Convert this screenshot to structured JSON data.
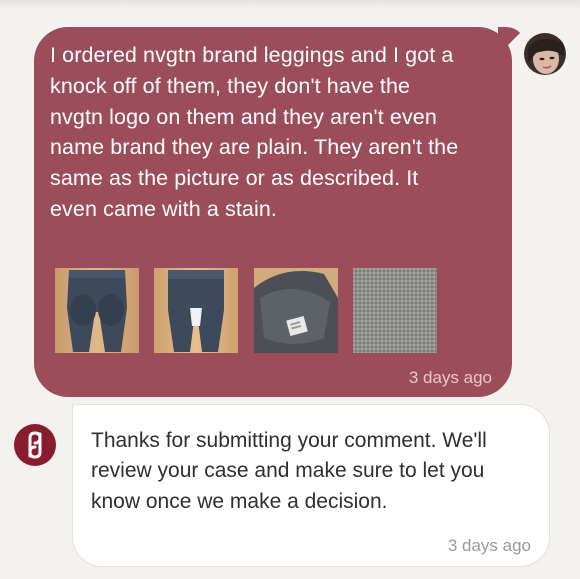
{
  "user_message": {
    "text": "I ordered nvgtn brand leggings and I got a\nknock off of them, they don't have the\nnvgtn logo on them and they aren't even\nname brand they are plain. They aren't the\nsame as the picture or as described. It\neven came with a stain.",
    "timestamp": "3 days ago",
    "bubble_color": "#9c4d5b",
    "attachments": [
      {
        "name": "leggings-back-view-photo"
      },
      {
        "name": "leggings-front-view-photo"
      },
      {
        "name": "leggings-tag-closeup-photo"
      },
      {
        "name": "fabric-stain-closeup-photo"
      }
    ]
  },
  "reply_message": {
    "text": "Thanks for submitting your comment. We'll\nreview your case and make sure to let you\nknow once we make a decision.",
    "timestamp": "3 days ago",
    "brand_icon": "poshmark-logo-icon",
    "brand_color": "#8a1d2d"
  },
  "avatar": {
    "icon": "user-avatar-photo"
  }
}
